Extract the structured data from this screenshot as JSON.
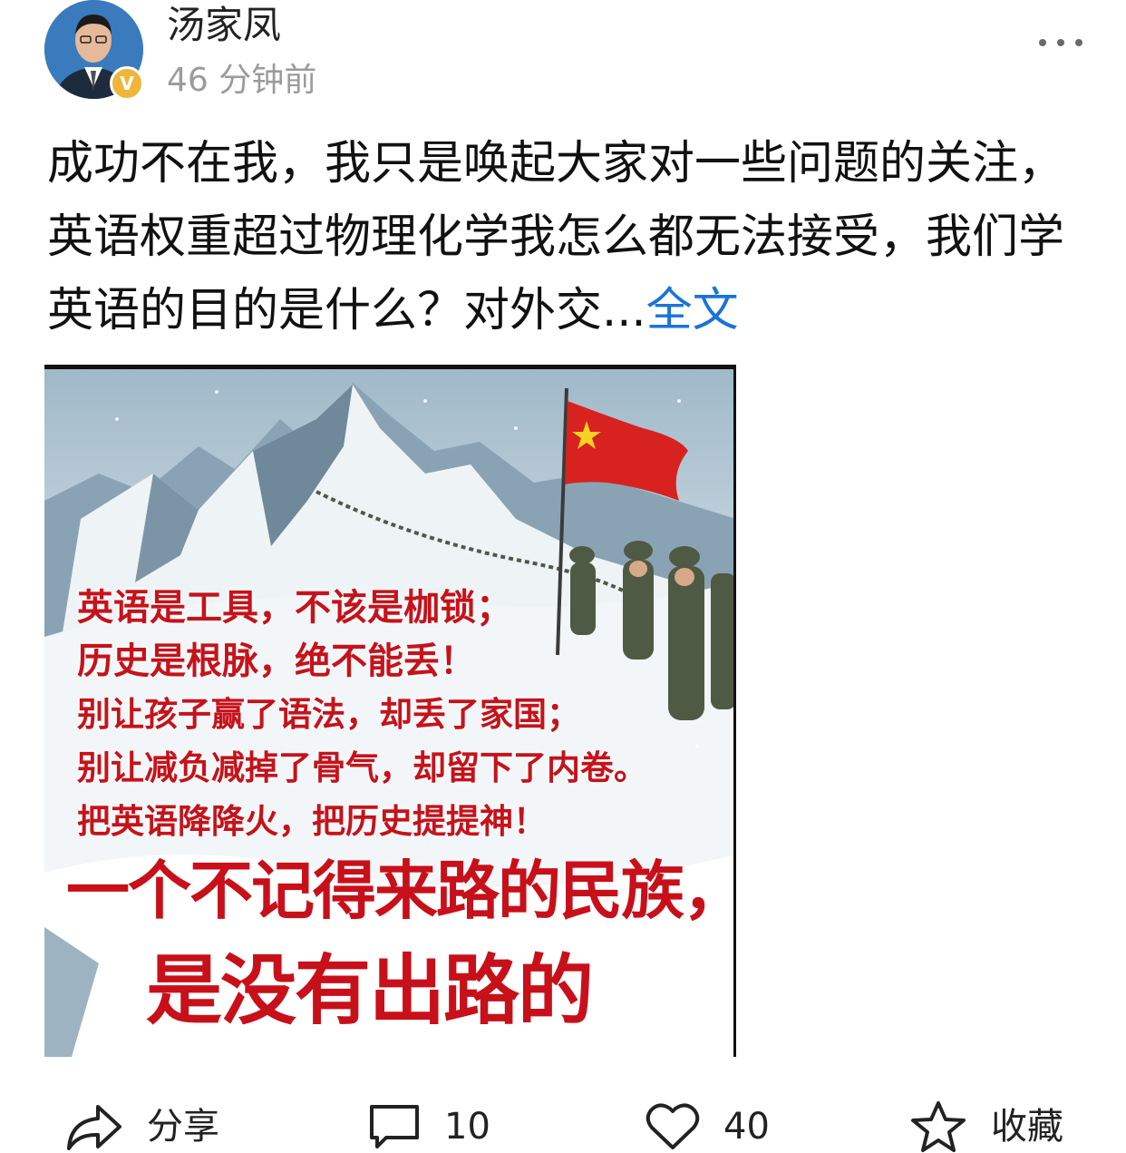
{
  "author": {
    "name": "汤家凤",
    "verified_badge": "V",
    "timestamp": "46 分钟前"
  },
  "post": {
    "text": "成功不在我，我只是唤起大家对一些问题的关注，英语权重超过物理化学我怎么都无法接受，我们学英语的目的是什么？对外交...",
    "expand_label": "全文"
  },
  "image": {
    "lines": [
      "英语是工具，不该是枷锁；",
      "历史是根脉，绝不能丢！",
      "别让孩子赢了语法，却丢了家国；",
      "别让减负减掉了骨气，却留下了内卷。",
      "把英语降降火，把历史提提神！"
    ],
    "headline_1": "一个不记得来路的民族，",
    "headline_2": "是没有出路的"
  },
  "actions": {
    "share_label": "分享",
    "comment_count": "10",
    "like_count": "40",
    "favorite_label": "收藏"
  },
  "colors": {
    "link": "#1a73d9",
    "poster_red": "#c8101a",
    "badge": "#f0b63a",
    "muted": "#9b9b9b"
  },
  "icons": [
    "more-icon",
    "share-icon",
    "comment-icon",
    "heart-icon",
    "star-icon"
  ]
}
